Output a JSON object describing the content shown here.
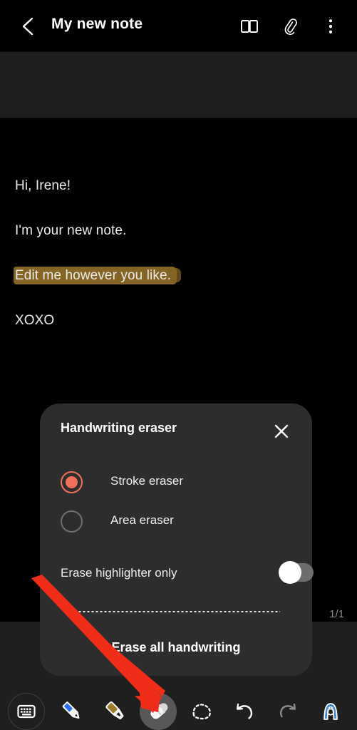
{
  "header": {
    "back_icon": "back-chevron-icon",
    "title": "My new note",
    "icons": [
      {
        "name": "reading-mode-icon",
        "label": "Reading mode"
      },
      {
        "name": "attachment-icon",
        "label": "Attach"
      },
      {
        "name": "more-options-icon",
        "label": "More options"
      }
    ]
  },
  "note": {
    "lines": [
      "Hi, Irene!",
      "I'm your new note.",
      "Edit me however you like.",
      "XOXO"
    ],
    "highlight_color": "#8c6a26",
    "page_indicator": "1/1"
  },
  "dialog": {
    "title": "Handwriting eraser",
    "close_icon": "close-icon",
    "options": [
      {
        "label": "Stroke eraser",
        "selected": true
      },
      {
        "label": "Area eraser",
        "selected": false
      }
    ],
    "toggle": {
      "label": "Erase highlighter only",
      "on": false
    },
    "action": "Erase all handwriting",
    "accent_color": "#f1705a",
    "background_color": "#2d2d2d"
  },
  "toolbar": {
    "items": [
      {
        "name": "keyboard-tool",
        "label": "Keyboard",
        "selected": false
      },
      {
        "name": "pen-tool",
        "label": "Pen",
        "selected": false
      },
      {
        "name": "highlighter-tool",
        "label": "Highlighter",
        "selected": false
      },
      {
        "name": "eraser-tool",
        "label": "Eraser",
        "selected": true
      },
      {
        "name": "lasso-select-tool",
        "label": "Selection",
        "selected": false
      },
      {
        "name": "undo-button",
        "label": "Undo",
        "selected": false
      },
      {
        "name": "redo-button",
        "label": "Redo",
        "selected": false
      },
      {
        "name": "text-convert-tool",
        "label": "Convert to text",
        "selected": false
      }
    ]
  },
  "annotation": {
    "arrow_color": "#f02d18",
    "points_to": "eraser-tool"
  }
}
